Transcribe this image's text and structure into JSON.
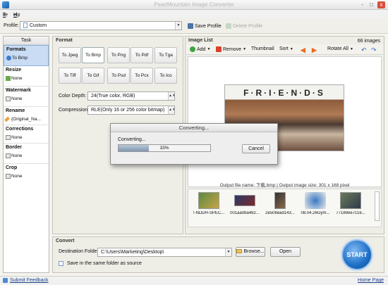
{
  "window": {
    "title": "PearlMountain Image Converter",
    "controls": [
      "-",
      "□",
      "x"
    ]
  },
  "menu": {
    "file": "F",
    "file_rest": "ile",
    "help": "H",
    "help_rest": "elp"
  },
  "profile": {
    "label": "Profile:",
    "value": "Custom",
    "save": "Save Profile",
    "delete": "Delete Profile"
  },
  "task_panel": {
    "header": "Task",
    "items": [
      {
        "title": "Formats",
        "value": "To Bmp"
      },
      {
        "title": "Resize",
        "value": "None"
      },
      {
        "title": "Watermark",
        "value": "None"
      },
      {
        "title": "Rename",
        "value": "{Original_Na..."
      },
      {
        "title": "Corrections",
        "value": "None"
      },
      {
        "title": "Border",
        "value": "None"
      },
      {
        "title": "Crop",
        "value": "None"
      }
    ]
  },
  "format": {
    "header": "Format",
    "buttons_row1": [
      "To Jpeg",
      "To Bmp",
      "To Png",
      "To Pdf",
      "To Tga"
    ],
    "buttons_row2": [
      "To Tiff",
      "To Gif",
      "To Psd",
      "To Pcx",
      "To Ico"
    ],
    "selected": "To Bmp",
    "color_depth_label": "Color Depth:",
    "color_depth_value": "24(True color, RGB)",
    "compression_label": "Compression:",
    "compression_value": "RLE(Only 16 or 256 color bitmap)"
  },
  "image_list": {
    "header": "Image List",
    "count": "66 images",
    "toolbar": {
      "add": "Add",
      "remove": "Remove",
      "thumbnail": "Thumbnail",
      "sort": "Sort",
      "rotate": "Rotate All"
    },
    "preview_text": "F·R·I·E·N·D·S",
    "output_info": "Output file name: 下载.bmp | Output image size: 301 x 168 pixel",
    "thumbs": [
      "!-NDDH-SPEC...",
      "001aa0ba492...",
      "2e508ead143...",
      "08.04.26Gym...",
      "77189ee7c16..."
    ]
  },
  "convert": {
    "header": "Convert",
    "dest_label": "Destination Folder:",
    "dest_value": "C:\\Users\\Marketing\\Desktop\\",
    "browse": "Browse...",
    "open": "Open",
    "same_folder": "Save in the same folder as source",
    "start": "START"
  },
  "dialog": {
    "title": "Converting...",
    "message": "Converting...",
    "progress_text": "33%",
    "progress_value": 33,
    "cancel": "Cancel"
  },
  "status": {
    "feedback": "Submit Feedback",
    "home": "Home Page"
  },
  "colors": {
    "accent": "#2f7fd6",
    "start": "#1d6fc6",
    "remove": "#d9412b",
    "add": "#3ea33e"
  }
}
